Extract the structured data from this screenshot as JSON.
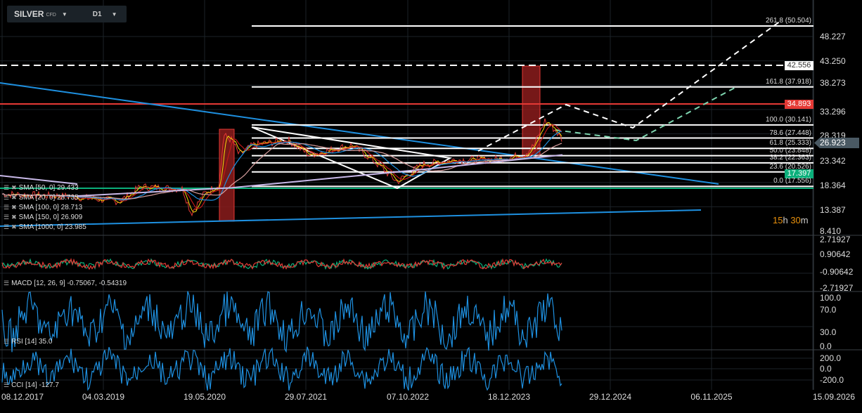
{
  "header": {
    "symbol": "SILVER",
    "type": "CFD",
    "timeframe": "D1"
  },
  "price_axis": [
    "48.227",
    "43.250",
    "38.273",
    "33.296",
    "28.319",
    "23.342",
    "18.364",
    "13.387",
    "8.410"
  ],
  "macd_axis": [
    "2.71927",
    "0.90642",
    "-0.90642",
    "-2.71927"
  ],
  "rsi_axis": [
    "100.0",
    "70.0",
    "30.0",
    "0.0"
  ],
  "cci_axis": [
    "200.0",
    "0.0",
    "-200.0"
  ],
  "dates": [
    "08.12.2017",
    "04.03.2019",
    "19.05.2020",
    "29.07.2021",
    "07.10.2022",
    "18.12.2023",
    "29.12.2024",
    "06.11.2025",
    "15.09.2026"
  ],
  "tags": {
    "dashed": "42.556",
    "red": "34.893",
    "current": "26.923",
    "green": "17.397"
  },
  "fib": [
    "261.8 (50.504)",
    "161.8 (37.918)",
    "100.0 (30.141)",
    "78.6 (27.448)",
    "61.8 (25.333)",
    "50.0 (23.848)",
    "38.2 (22.363)",
    "23.6 (20.526)",
    "0.0 (17.556)"
  ],
  "fib_values": [
    50.504,
    37.918,
    30.141,
    27.448,
    25.333,
    23.848,
    22.363,
    20.526,
    17.556
  ],
  "sma": [
    "SMA [50, 0] 29.433",
    "SMA [20, 0] 28.735",
    "SMA [100, 0] 28.713",
    "SMA [150, 0] 26.909",
    "SMA [1000, 0] 23.985"
  ],
  "indicators": {
    "macd": "MACD [12, 26, 9] -0.75067, -0.54319",
    "rsi": "RSI [14] 35.0",
    "cci": "CCI [14] -127.7"
  },
  "timer": {
    "h": "15",
    "h_unit": "h",
    "m": "30",
    "m_unit": "m"
  },
  "colors": {
    "red": "#e53935",
    "green": "#0bb07b",
    "blue": "#1e90e0",
    "current": "#4a5963"
  }
}
